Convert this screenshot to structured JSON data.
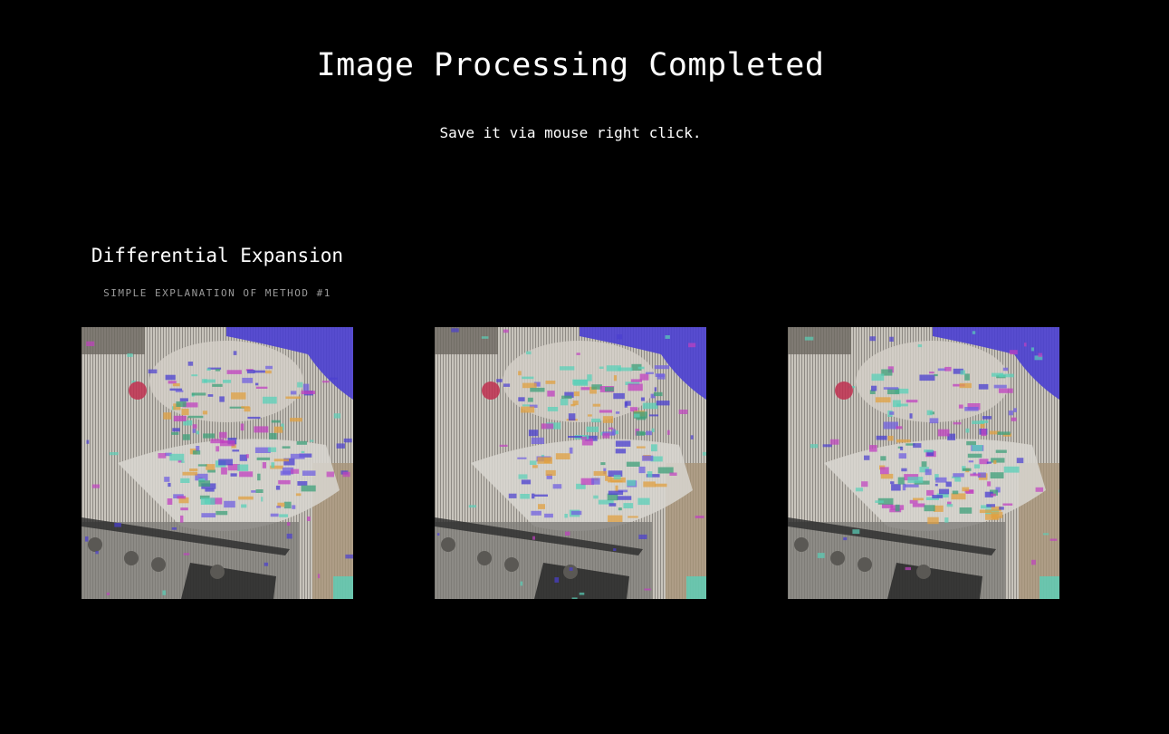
{
  "header": {
    "title": "Image Processing Completed",
    "subtitle": "Save it via mouse right click."
  },
  "section": {
    "title": "Differential Expansion",
    "link_label": "SIMPLE EXPLANATION OF METHOD #1"
  },
  "results": {
    "images": [
      {
        "name": "processed-image-1"
      },
      {
        "name": "processed-image-2"
      },
      {
        "name": "processed-image-3"
      }
    ]
  },
  "colors": {
    "background": "#000000",
    "text": "#ffffff",
    "muted": "#9a9a9a",
    "accent_blue": "#4a3fd0",
    "accent_teal": "#5ad0b8",
    "accent_magenta": "#c040c0"
  }
}
